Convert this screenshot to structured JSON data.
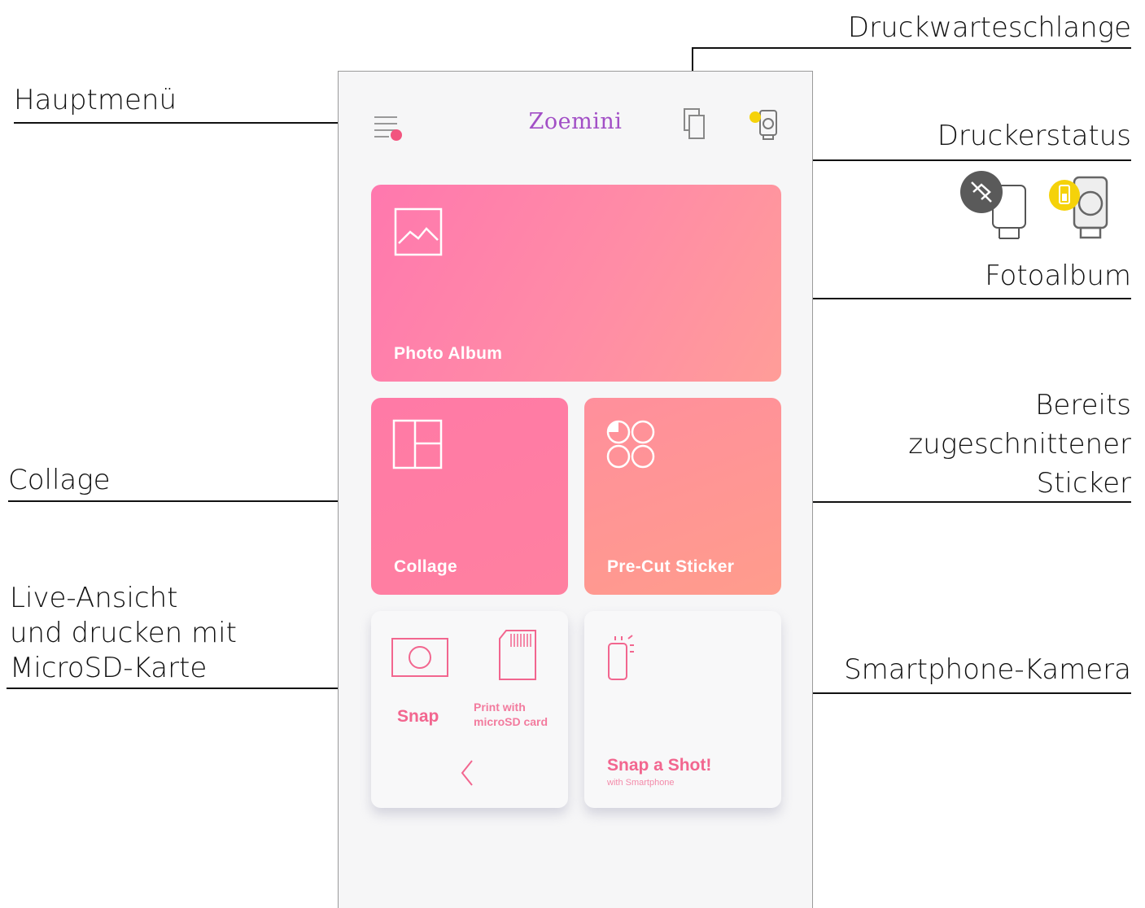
{
  "callouts": {
    "main_menu": "Hauptmenü",
    "print_queue": "Druckwarteschlange",
    "printer_status": "Druckerstatus",
    "photo_album": "Fotoalbum",
    "precut_line1": "Bereits",
    "precut_line2": "zugeschnittener",
    "precut_line3": "Sticker",
    "collage": "Collage",
    "live_line1": "Live-Ansicht",
    "live_line2": "und drucken mit",
    "live_line3": "MicroSD-Karte",
    "smartphone_camera": "Smartphone-Kamera"
  },
  "app": {
    "title": "Zoemini",
    "cards": {
      "photo_album": "Photo Album",
      "collage": "Collage",
      "precut_sticker": "Pre-Cut Sticker",
      "snap": "Snap",
      "print_sd_line1": "Print with",
      "print_sd_line2": "microSD card",
      "snap_shot": "Snap a Shot!",
      "snap_shot_sub": "with Smartphone"
    }
  },
  "colors": {
    "accent_pink": "#f2668f",
    "title_purple": "#a24fc6",
    "battery_yellow": "#f5d20a",
    "disconnected_grey": "#555555"
  },
  "icons": [
    "menu-icon",
    "print-queue-icon",
    "printer-status-icon",
    "image-icon",
    "collage-layout-icon",
    "sticker-shapes-icon",
    "camera-icon",
    "sd-card-icon",
    "chevron-left-icon",
    "smartphone-icon",
    "bluetooth-off-icon",
    "battery-icon"
  ]
}
